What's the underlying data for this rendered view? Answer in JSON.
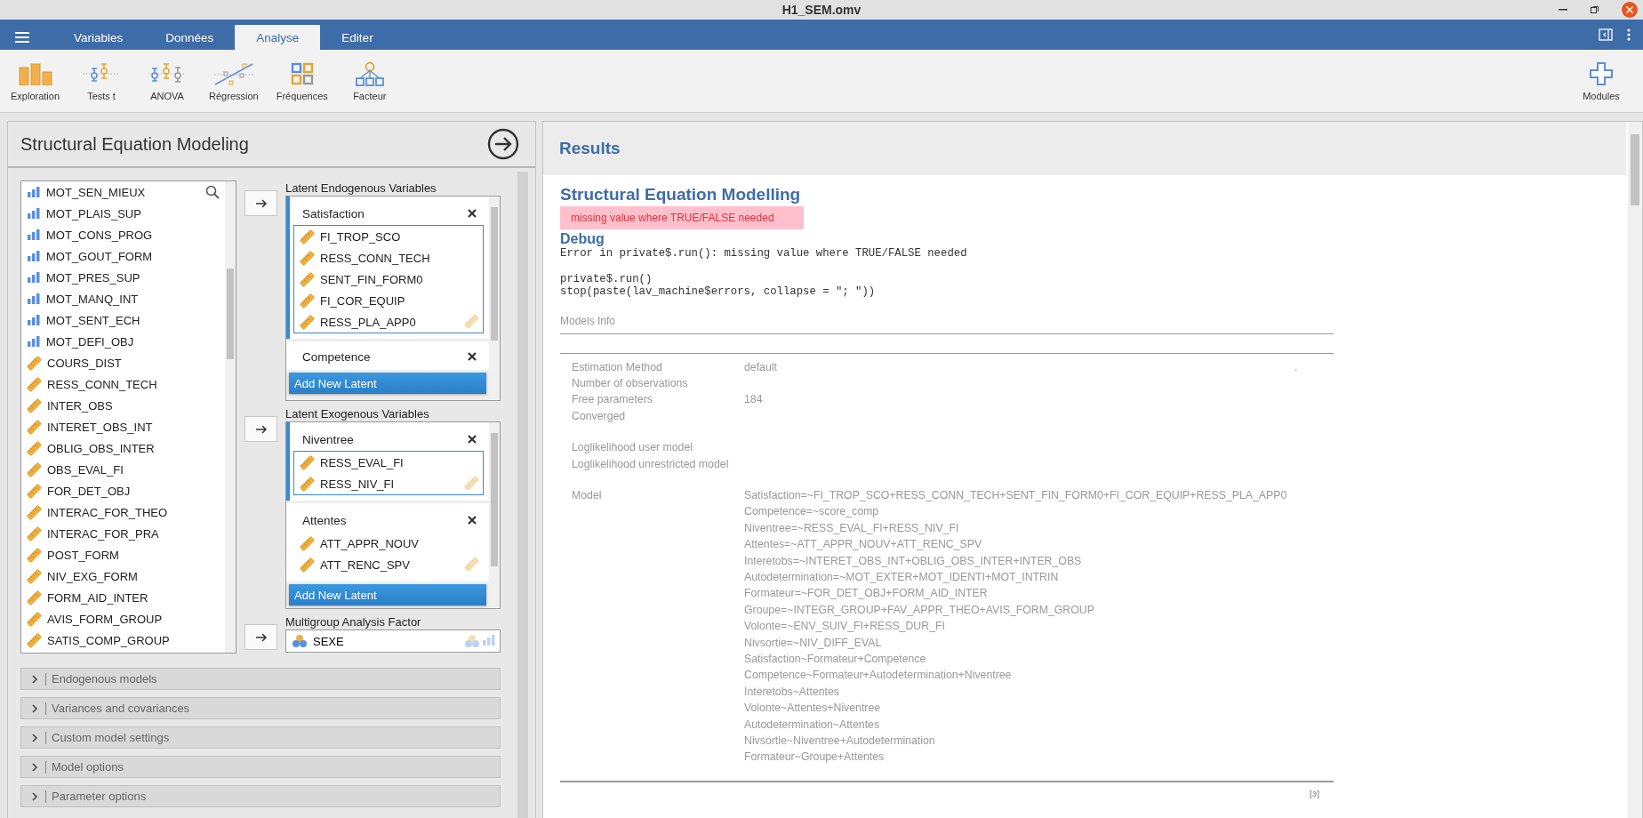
{
  "window": {
    "title": "H1_SEM.omv"
  },
  "tabs": [
    {
      "label": "Variables",
      "selected": false
    },
    {
      "label": "Données",
      "selected": false
    },
    {
      "label": "Analyse",
      "selected": true
    },
    {
      "label": "Editer",
      "selected": false
    }
  ],
  "toolbar": [
    {
      "label": "Exploration",
      "kind": "exploration"
    },
    {
      "label": "Tests t",
      "kind": "ttest"
    },
    {
      "label": "ANOVA",
      "kind": "anova"
    },
    {
      "label": "Régression",
      "kind": "regression"
    },
    {
      "label": "Fréquences",
      "kind": "frequencies"
    },
    {
      "label": "Facteur",
      "kind": "factor"
    }
  ],
  "modules": {
    "label": "Modules"
  },
  "analysis": {
    "title": "Structural Equation Modeling",
    "variables": [
      {
        "name": "MOT_SEN_MIEUX",
        "kind": "ordinal"
      },
      {
        "name": "MOT_PLAIS_SUP",
        "kind": "ordinal"
      },
      {
        "name": "MOT_CONS_PROG",
        "kind": "ordinal"
      },
      {
        "name": "MOT_GOUT_FORM",
        "kind": "ordinal"
      },
      {
        "name": "MOT_PRES_SUP",
        "kind": "ordinal"
      },
      {
        "name": "MOT_MANQ_INT",
        "kind": "ordinal"
      },
      {
        "name": "MOT_SENT_ECH",
        "kind": "ordinal"
      },
      {
        "name": "MOT_DEFI_OBJ",
        "kind": "ordinal"
      },
      {
        "name": "COURS_DIST",
        "kind": "continuous"
      },
      {
        "name": "RESS_CONN_TECH",
        "kind": "continuous"
      },
      {
        "name": "INTER_OBS",
        "kind": "continuous"
      },
      {
        "name": "INTERET_OBS_INT",
        "kind": "continuous"
      },
      {
        "name": "OBLIG_OBS_INTER",
        "kind": "continuous"
      },
      {
        "name": "OBS_EVAL_FI",
        "kind": "continuous"
      },
      {
        "name": "FOR_DET_OBJ",
        "kind": "continuous"
      },
      {
        "name": "INTERAC_FOR_THEO",
        "kind": "continuous"
      },
      {
        "name": "INTERAC_FOR_PRA",
        "kind": "continuous"
      },
      {
        "name": "POST_FORM",
        "kind": "continuous"
      },
      {
        "name": "NIV_EXG_FORM",
        "kind": "continuous"
      },
      {
        "name": "FORM_AID_INTER",
        "kind": "continuous"
      },
      {
        "name": "AVIS_FORM_GROUP",
        "kind": "continuous"
      },
      {
        "name": "SATIS_COMP_GROUP",
        "kind": "continuous"
      }
    ],
    "endogenous": {
      "label": "Latent Endogenous Variables",
      "add_button": "Add New Latent",
      "groups": [
        {
          "name": "Satisfaction",
          "selected": true,
          "variables": [
            {
              "name": "FI_TROP_SCO",
              "kind": "continuous"
            },
            {
              "name": "RESS_CONN_TECH",
              "kind": "continuous"
            },
            {
              "name": "SENT_FIN_FORM0",
              "kind": "continuous"
            },
            {
              "name": "FI_COR_EQUIP",
              "kind": "continuous"
            },
            {
              "name": "RESS_PLA_APP0",
              "kind": "continuous"
            }
          ]
        },
        {
          "name": "Competence",
          "selected": false
        }
      ]
    },
    "exogenous": {
      "label": "Latent Exogenous Variables",
      "add_button": "Add New Latent",
      "groups": [
        {
          "name": "Niventree",
          "selected": true,
          "variables": [
            {
              "name": "RESS_EVAL_FI",
              "kind": "continuous"
            },
            {
              "name": "RESS_NIV_FI",
              "kind": "continuous"
            }
          ]
        },
        {
          "name": "Attentes",
          "selected": false,
          "variables": [
            {
              "name": "ATT_APPR_NOUV",
              "kind": "continuous"
            },
            {
              "name": "ATT_RENC_SPV",
              "kind": "continuous"
            }
          ]
        }
      ]
    },
    "multigroup": {
      "label": "Multigroup Analysis Factor",
      "variable": {
        "name": "SEXE",
        "kind": "nominal"
      }
    },
    "sections": [
      {
        "label": "Endogenous models",
        "expanded": false
      },
      {
        "label": "Variances and covariances",
        "expanded": false
      },
      {
        "label": "Custom model settings",
        "expanded": false
      },
      {
        "label": "Model options",
        "expanded": false
      },
      {
        "label": "Parameter options",
        "expanded": false
      }
    ]
  },
  "results": {
    "header": "Results",
    "title": "Structural Equation Modelling",
    "error": "missing value where TRUE/FALSE needed",
    "debug_title": "Debug",
    "debug_blocks": [
      [
        "Error in private$.run(): missing value where TRUE/FALSE needed"
      ],
      [
        "private$.run()",
        "stop(paste(lav_machine$errors, collapse = \"; \"))"
      ]
    ],
    "models_info": {
      "title": "Models Info",
      "groups": [
        [
          {
            "label": "Estimation Method",
            "value": "default",
            "column_3": "."
          },
          {
            "label": "Number of observations"
          },
          {
            "label": "Free parameters",
            "value": "184"
          },
          {
            "label": "Converged"
          }
        ],
        [
          {
            "label": "Loglikelihood user model"
          },
          {
            "label": "Loglikelihood unrestricted model"
          }
        ],
        [
          {
            "label": "Model",
            "values": [
              "Satisfaction=~FI_TROP_SCO+RESS_CONN_TECH+SENT_FIN_FORM0+FI_COR_EQUIP+RESS_PLA_APP0",
              "Competence=~score_comp",
              "Niventree=~RESS_EVAL_FI+RESS_NIV_FI",
              "Attentes=~ATT_APPR_NOUV+ATT_RENC_SPV",
              "Interetobs=~INTERET_OBS_INT+OBLIG_OBS_INTER+INTER_OBS",
              "Autodetermination=~MOT_EXTER+MOT_IDENTI+MOT_INTRIN",
              "Formateur=~FOR_DET_OBJ+FORM_AID_INTER",
              "Groupe=~INTEGR_GROUP+FAV_APPR_THEO+AVIS_FORM_GROUP",
              "Volonte=~ENV_SUIV_FI+RESS_DUR_FI",
              "Nivsortie=~NIV_DIFF_EVAL",
              "Satisfaction~Formateur+Competence",
              "Competence~Formateur+Autodetermination+Niventree",
              "Interetobs~Attentes",
              "Volonte~Attentes+Niventree",
              "Autodetermination~Attentes",
              "Nivsortie~Niventree+Autodetermination",
              "Formateur~Groupe+Attentes"
            ]
          }
        ]
      ],
      "footnote": "[3]"
    }
  }
}
